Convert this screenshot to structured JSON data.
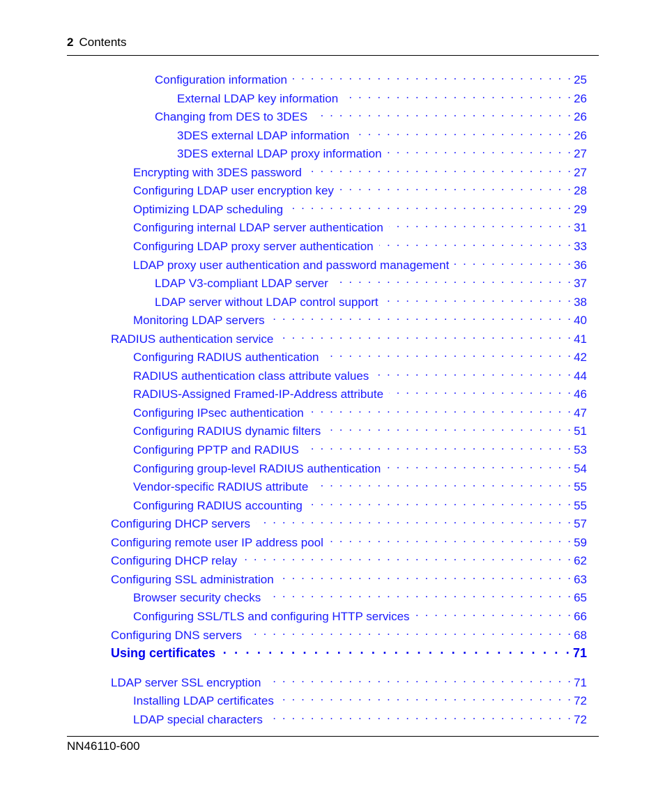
{
  "header": {
    "page_number": "2",
    "section": "Contents"
  },
  "footer": {
    "doc_id": "NN46110-600"
  },
  "colors": {
    "link": "#1a1aff",
    "text": "#000000"
  },
  "toc": [
    {
      "level": 2,
      "title": "Configuration information",
      "page": "25"
    },
    {
      "level": 3,
      "title": "External LDAP key information",
      "page": "26"
    },
    {
      "level": 2,
      "title": "Changing from DES to 3DES",
      "page": "26"
    },
    {
      "level": 3,
      "title": "3DES external LDAP information",
      "page": "26"
    },
    {
      "level": 3,
      "title": "3DES external LDAP proxy information",
      "page": "27"
    },
    {
      "level": 1,
      "title": "Encrypting with 3DES password",
      "page": "27"
    },
    {
      "level": 1,
      "title": "Configuring LDAP user encryption key",
      "page": "28"
    },
    {
      "level": 1,
      "title": "Optimizing LDAP scheduling",
      "page": "29"
    },
    {
      "level": 1,
      "title": "Configuring internal LDAP server authentication",
      "page": "31"
    },
    {
      "level": 1,
      "title": "Configuring LDAP proxy server authentication",
      "page": "33"
    },
    {
      "level": 1,
      "title": "LDAP proxy user authentication and password management",
      "page": "36"
    },
    {
      "level": 2,
      "title": "LDAP V3-compliant LDAP server",
      "page": "37"
    },
    {
      "level": 2,
      "title": "LDAP server without LDAP control support",
      "page": "38"
    },
    {
      "level": 1,
      "title": "Monitoring LDAP servers",
      "page": "40"
    },
    {
      "level": 0,
      "title": "RADIUS authentication service",
      "page": "41"
    },
    {
      "level": 1,
      "title": "Configuring RADIUS authentication",
      "page": "42"
    },
    {
      "level": 1,
      "title": "RADIUS authentication class attribute values",
      "page": "44"
    },
    {
      "level": 1,
      "title": "RADIUS-Assigned Framed-IP-Address attribute",
      "page": "46"
    },
    {
      "level": 1,
      "title": "Configuring IPsec authentication",
      "page": "47"
    },
    {
      "level": 1,
      "title": "Configuring RADIUS dynamic filters",
      "page": "51"
    },
    {
      "level": 1,
      "title": "Configuring PPTP and RADIUS",
      "page": "53"
    },
    {
      "level": 1,
      "title": "Configuring group-level RADIUS authentication",
      "page": "54"
    },
    {
      "level": 1,
      "title": "Vendor-specific RADIUS attribute",
      "page": "55"
    },
    {
      "level": 1,
      "title": "Configuring RADIUS accounting",
      "page": "55"
    },
    {
      "level": 0,
      "title": "Configuring DHCP servers",
      "page": "57"
    },
    {
      "level": 0,
      "title": "Configuring remote user IP address pool",
      "page": "59"
    },
    {
      "level": 0,
      "title": "Configuring DHCP relay",
      "page": "62"
    },
    {
      "level": 0,
      "title": "Configuring SSL administration",
      "page": "63"
    },
    {
      "level": 1,
      "title": "Browser security checks",
      "page": "65"
    },
    {
      "level": 1,
      "title": "Configuring SSL/TLS and configuring HTTP services",
      "page": "66"
    },
    {
      "level": 0,
      "title": "Configuring DNS servers",
      "page": "68"
    },
    {
      "level": "chapter",
      "title": "Using certificates",
      "page": "71"
    },
    {
      "level": 0,
      "title": "LDAP server SSL encryption",
      "page": "71"
    },
    {
      "level": 1,
      "title": "Installing LDAP certificates",
      "page": "72"
    },
    {
      "level": 1,
      "title": "LDAP special characters",
      "page": "72"
    }
  ]
}
